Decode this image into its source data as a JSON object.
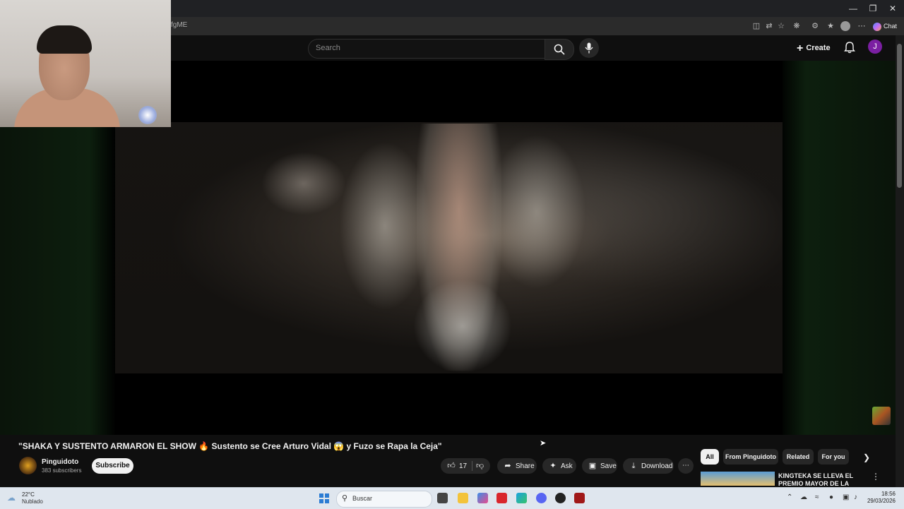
{
  "browser": {
    "url_fragment": "fgME",
    "chat_label": "Chat",
    "window_controls": [
      "minimize-icon",
      "restore-icon",
      "close-icon"
    ]
  },
  "youtube_header": {
    "search_placeholder": "Search",
    "create_label": "Create",
    "avatar_letter": "J"
  },
  "video": {
    "title": "\"SHAKA Y SUSTENTO ARMARON EL SHOW 🔥 Sustento se Cree Arturo Vidal 😱 y Fuzo se Rapa la Ceja\"",
    "channel_name": "Pinguidoto",
    "subscribers": "383 subscribers",
    "subscribe_label": "Subscribe"
  },
  "actions": {
    "like_count": "17",
    "share_label": "Share",
    "ask_label": "Ask",
    "save_label": "Save",
    "download_label": "Download"
  },
  "chips": [
    "All",
    "From Pinguidoto",
    "Related",
    "For you"
  ],
  "recommendation": {
    "title": "KINGTEKA SE LLEVA EL PREMIO MAYOR DE LA RULET"
  },
  "taskbar": {
    "temperature": "22°C",
    "weather": "Nublado",
    "search_label": "Buscar",
    "time": "18:56",
    "date": "29/03/2026"
  }
}
